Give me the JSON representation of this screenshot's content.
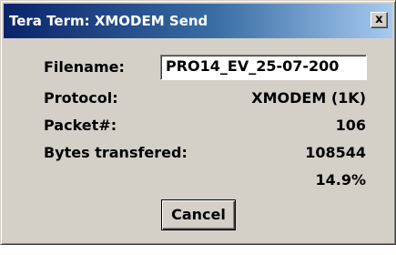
{
  "window": {
    "title": "Tera Term: XMODEM Send",
    "close_glyph": "x"
  },
  "colors": {
    "titlebar_start": "#0a246a",
    "titlebar_end": "#a6caf0",
    "face": "#d4d0c8"
  },
  "fields": {
    "filename_label": "Filename:",
    "filename_value": "PRO14_EV_25-07-200",
    "protocol_label": "Protocol:",
    "protocol_value": "XMODEM (1K)",
    "packet_label": "Packet#:",
    "packet_value": "106",
    "bytes_label": "Bytes transfered:",
    "bytes_value": "108544",
    "percent_value": "14.9%"
  },
  "buttons": {
    "cancel_label": "Cancel"
  }
}
